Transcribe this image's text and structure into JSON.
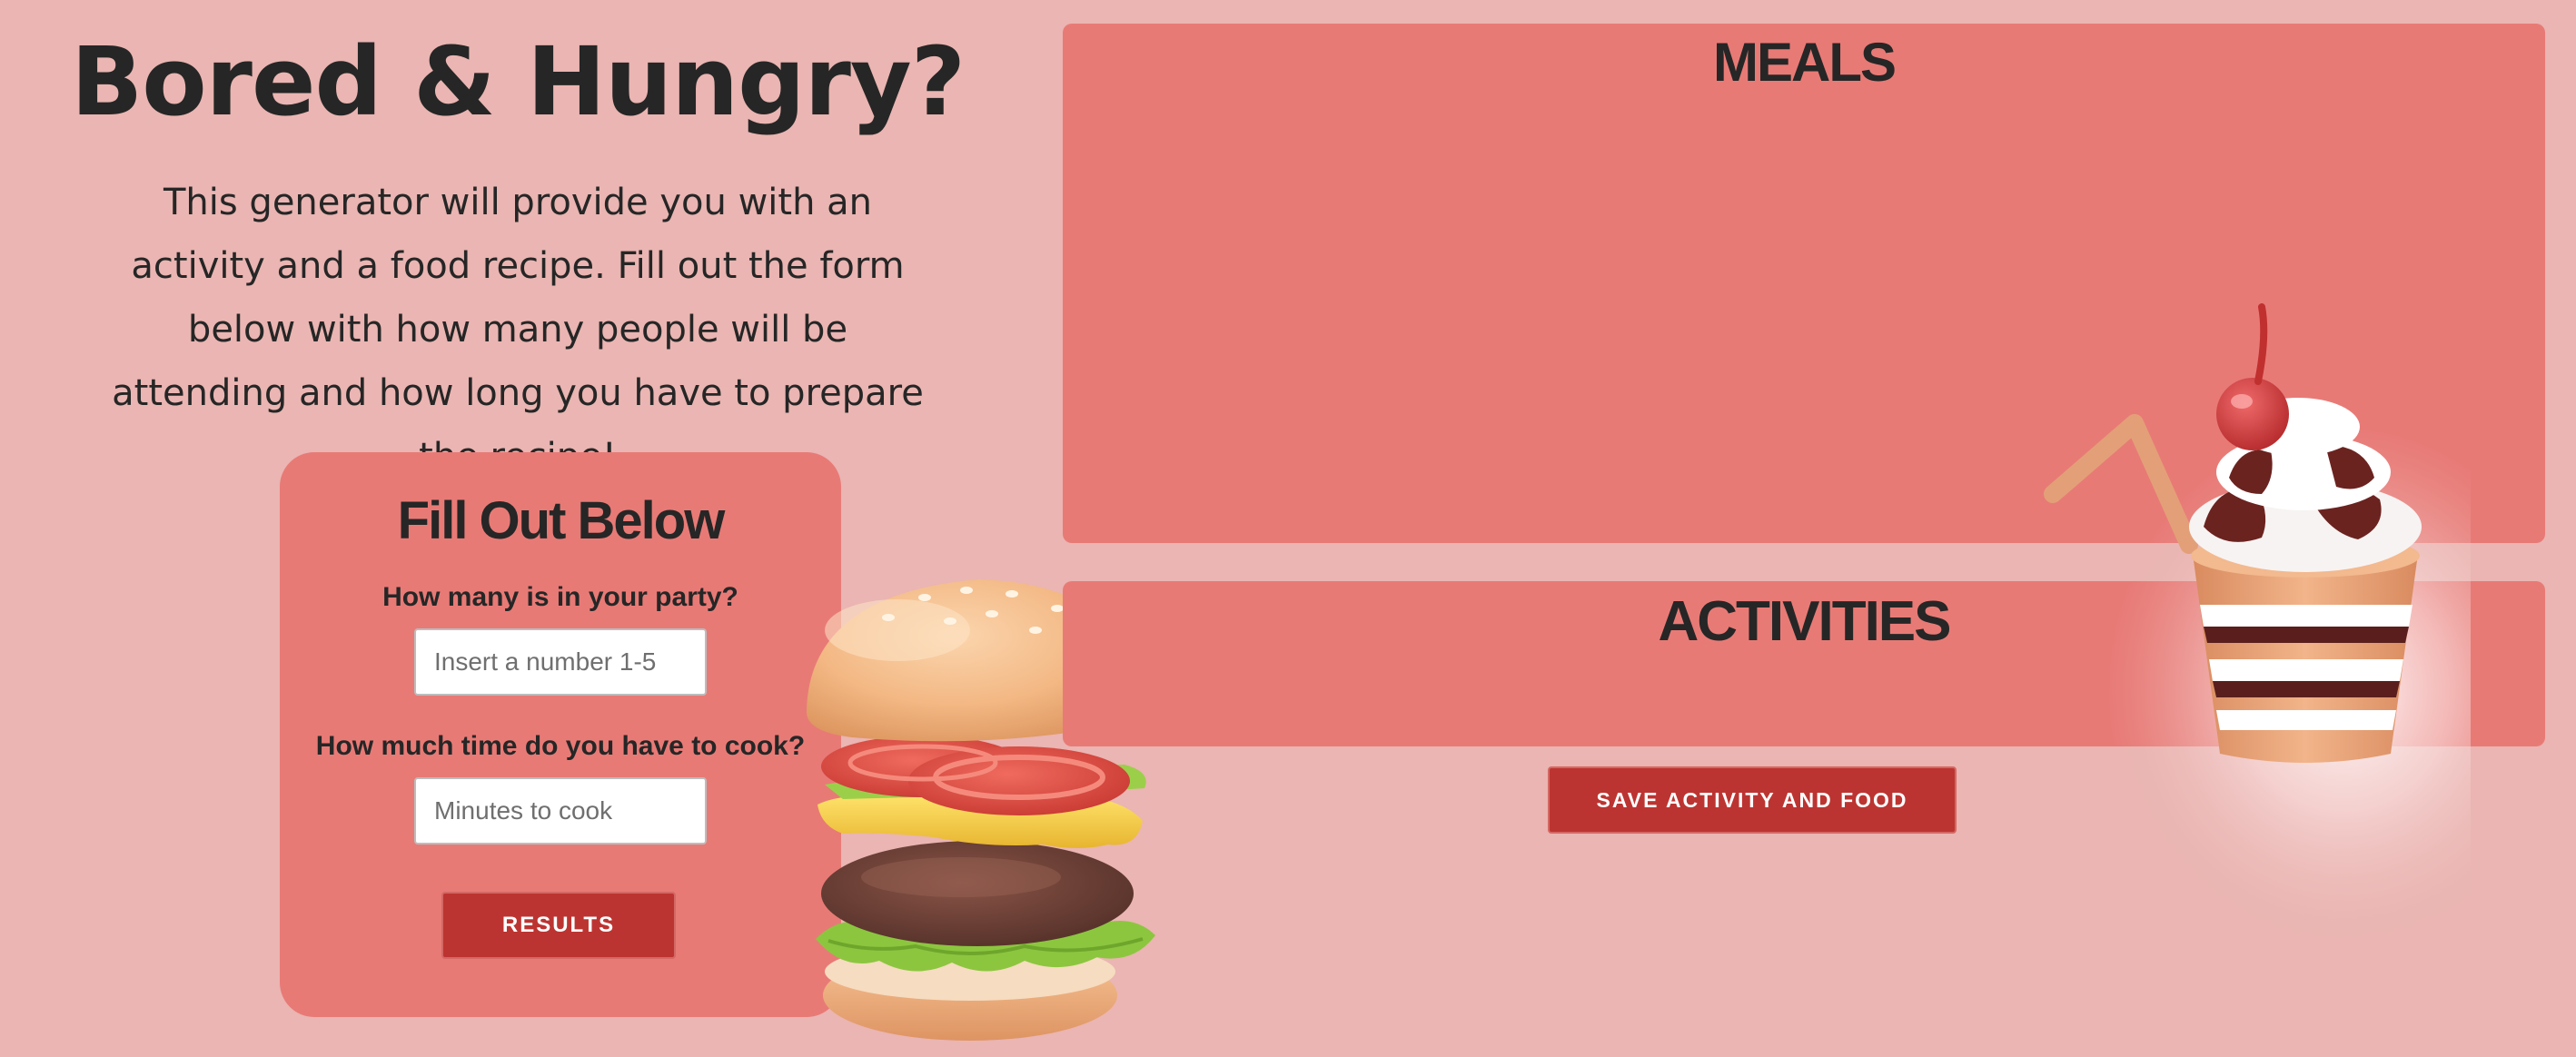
{
  "hero": {
    "title": "Bored & Hungry?",
    "intro": "This generator will provide you with an activity and a food recipe. Fill out the form below with how many people will be attending and how long you have to prepare the recipe!"
  },
  "form": {
    "heading": "Fill Out Below",
    "party_label": "How many is in your party?",
    "party_placeholder": "Insert a number 1-5",
    "party_value": "",
    "time_label": "How much time do you have to cook?",
    "time_placeholder": "Minutes to cook",
    "time_value": "",
    "results_button": "RESULTS"
  },
  "meals": {
    "title": "MEALS"
  },
  "activities": {
    "title": "ACTIVITIES"
  },
  "save_button": "SAVE ACTIVITY AND FOOD",
  "illustrations": {
    "burger": "burger-illustration",
    "milkshake": "milkshake-illustration"
  },
  "colors": {
    "background": "#eab5b2",
    "panel": "#e87a76",
    "button": "#bc3431",
    "text": "#262626"
  }
}
